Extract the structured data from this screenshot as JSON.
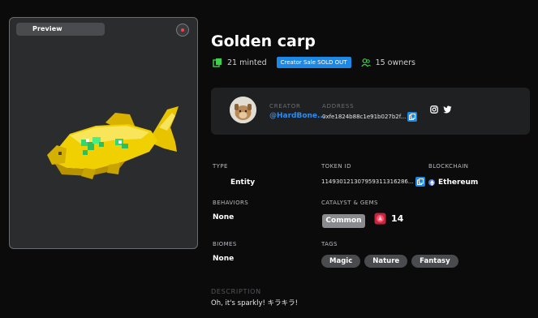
{
  "preview": {
    "label": "Preview",
    "accent": "#ff3b4e"
  },
  "asset": {
    "title": "Golden carp",
    "minted_text": "21 minted",
    "sale_badge": "Creator Sale SOLD OUT",
    "owners_text": "15 owners",
    "icons": [
      "copies-icon",
      "owners-icon"
    ],
    "colors": {
      "accent_green": "#3ecf4a",
      "badge_blue": "#1e88e5"
    }
  },
  "creator": {
    "creator_label": "CREATOR",
    "creator_name": "@HardBone...",
    "address_label": "ADDRESS",
    "address_value": "0xfe1824b88c1e91b027b2f...",
    "social_icons": [
      "instagram-icon",
      "twitter-icon"
    ]
  },
  "details": {
    "type_label": "TYPE",
    "type_value": "Entity",
    "token_label": "TOKEN ID",
    "token_value": "114930121307959311316286...",
    "blockchain_label": "BLOCKCHAIN",
    "blockchain_value": "Ethereum",
    "behaviors_label": "BEHAVIORS",
    "behaviors_value": "None",
    "catalyst_label": "CATALYST & GEMS",
    "catalyst_value": "Common",
    "gems_count": "14",
    "biomes_label": "BIOMES",
    "biomes_value": "None",
    "tags_label": "TAGS",
    "tags": [
      "Magic",
      "Nature",
      "Fantasy"
    ]
  },
  "description": {
    "label": "DESCRIPTION",
    "text": "Oh, it's sparkly! キラキラ!"
  }
}
